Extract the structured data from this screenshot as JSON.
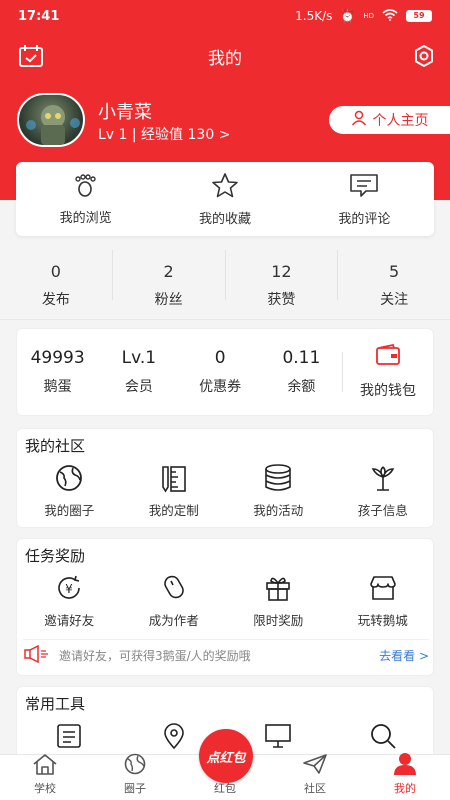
{
  "status": {
    "time": "17:41",
    "speed": "1.5K/s",
    "battery": "59",
    "hd": "HD"
  },
  "header": {
    "title": "我的"
  },
  "profile": {
    "name": "小青菜",
    "level_text": "Lv 1 | 经验值 130 >",
    "homepage_button": "个人主页"
  },
  "quick_actions": [
    {
      "label": "我的浏览",
      "icon": "footprint-icon"
    },
    {
      "label": "我的收藏",
      "icon": "star-icon"
    },
    {
      "label": "我的评论",
      "icon": "comment-icon"
    }
  ],
  "stats": [
    {
      "value": "0",
      "label": "发布"
    },
    {
      "value": "2",
      "label": "粉丝"
    },
    {
      "value": "12",
      "label": "获赞"
    },
    {
      "value": "5",
      "label": "关注"
    }
  ],
  "wallet": {
    "items": [
      {
        "value": "49993",
        "label": "鹅蛋"
      },
      {
        "value": "Lv.1",
        "label": "会员"
      },
      {
        "value": "0",
        "label": "优惠券"
      },
      {
        "value": "0.11",
        "label": "余额"
      }
    ],
    "purse_label": "我的钱包"
  },
  "community": {
    "title": "我的社区",
    "items": [
      {
        "label": "我的圈子",
        "icon": "globe-icon"
      },
      {
        "label": "我的定制",
        "icon": "ruler-pencil-icon"
      },
      {
        "label": "我的活动",
        "icon": "database-icon"
      },
      {
        "label": "孩子信息",
        "icon": "flower-icon"
      }
    ]
  },
  "tasks": {
    "title": "任务奖励",
    "items": [
      {
        "label": "邀请好友",
        "icon": "yen-refresh-icon"
      },
      {
        "label": "成为作者",
        "icon": "mouse-icon"
      },
      {
        "label": "限时奖励",
        "icon": "gift-icon"
      },
      {
        "label": "玩转鹅城",
        "icon": "shop-icon"
      }
    ],
    "notice": "邀请好友，可获得3鹅蛋/人的奖励哦",
    "notice_more": "去看看 >"
  },
  "tools": {
    "title": "常用工具"
  },
  "bottom_nav": [
    {
      "label": "学校",
      "icon": "house-icon"
    },
    {
      "label": "圈子",
      "icon": "globe-icon"
    },
    {
      "label": "红包",
      "icon": "redpacket-icon"
    },
    {
      "label": "社区",
      "icon": "paper-plane-icon"
    },
    {
      "label": "我的",
      "icon": "user-icon"
    }
  ],
  "red_badge": "点红包",
  "colors": {
    "brand": "#ee2b2e",
    "link": "#3a7bd5"
  }
}
